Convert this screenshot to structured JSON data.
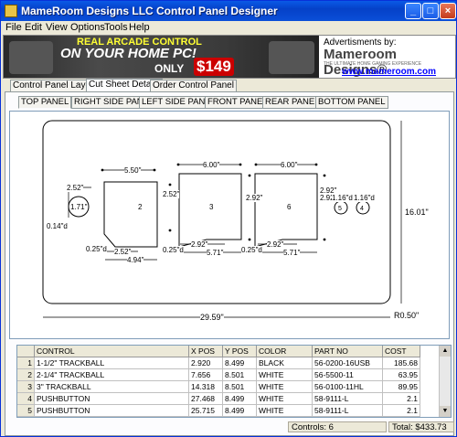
{
  "window": {
    "title": "MameRoom Designs LLC Control Panel Designer",
    "min": "_",
    "max": "□",
    "close": "×"
  },
  "menu": [
    "File",
    "Edit",
    "View",
    "Options",
    "Tools",
    "Help"
  ],
  "banner": {
    "line1": "REAL ARCADE CONTROL",
    "line2": "ON YOUR HOME PC!",
    "only": "ONLY",
    "price": "$149",
    "ads_title": "Advertisments by:",
    "brand": "Mameroom Designs®",
    "tagline": "THE ULTIMATE HOME GAMING EXPERIENCE",
    "url": "www.mameroom.com"
  },
  "tabs": [
    "Control Panel Layout",
    "Cut Sheet Details",
    "Order Control Panel"
  ],
  "subtabs": [
    "TOP PANEL",
    "RIGHT SIDE PANEL",
    "LEFT SIDE PANEL",
    "FRONT PANEL",
    "REAR PANEL",
    "BOTTOM PANEL"
  ],
  "drawing": {
    "d_552_a": "2.52\"",
    "d_171": "1.71\"",
    "d_014": "0.14\"d",
    "d_550": "5.50\"",
    "d_252_b": "2.52\"",
    "d_025_a": "0.25\"d",
    "d_252_c": "2.52\"",
    "d_494": "4.94\"",
    "d_600_a": "6.00\"",
    "d_292_a": "2.92\"",
    "d_025_b": "0.25\"d",
    "d_292_b": "2.92\"",
    "d_571_a": "5.71\"",
    "d_600_b": "6.00\"",
    "d_292_c": "2.92\"",
    "d_025_c": "0.25\"d",
    "d_292_d": "2.92\"",
    "d_571_b": "5.71\"",
    "d_292_e": "2.92\"",
    "d_116_a": "1.16\"d",
    "d_116_b": "1.16\"d",
    "height": "16.01\"",
    "width": "29.59\"",
    "radius": "R0.50\"",
    "labels": [
      "1",
      "2",
      "3",
      "6",
      "5",
      "4"
    ]
  },
  "grid": {
    "headers": [
      "CONTROL",
      "X POS",
      "Y POS",
      "COLOR",
      "PART NO",
      "COST"
    ],
    "rows": [
      [
        "1",
        "1-1/2\" TRACKBALL",
        "2.920",
        "8.499",
        "BLACK",
        "56-0200-16USB",
        "185.68"
      ],
      [
        "2",
        "2-1/4\" TRACKBALL",
        "7.656",
        "8.501",
        "WHITE",
        "56-5500-11",
        "63.95"
      ],
      [
        "3",
        "3\" TRACKBALL",
        "14.318",
        "8.501",
        "WHITE",
        "56-0100-11HL",
        "89.95"
      ],
      [
        "4",
        "PUSHBUTTON",
        "27.468",
        "8.499",
        "WHITE",
        "58-9111-L",
        "2.1"
      ],
      [
        "5",
        "PUSHBUTTON",
        "25.715",
        "8.499",
        "WHITE",
        "58-9111-L",
        "2.1"
      ]
    ]
  },
  "status": {
    "controls": "Controls: 6",
    "total": "Total: $433.73"
  }
}
